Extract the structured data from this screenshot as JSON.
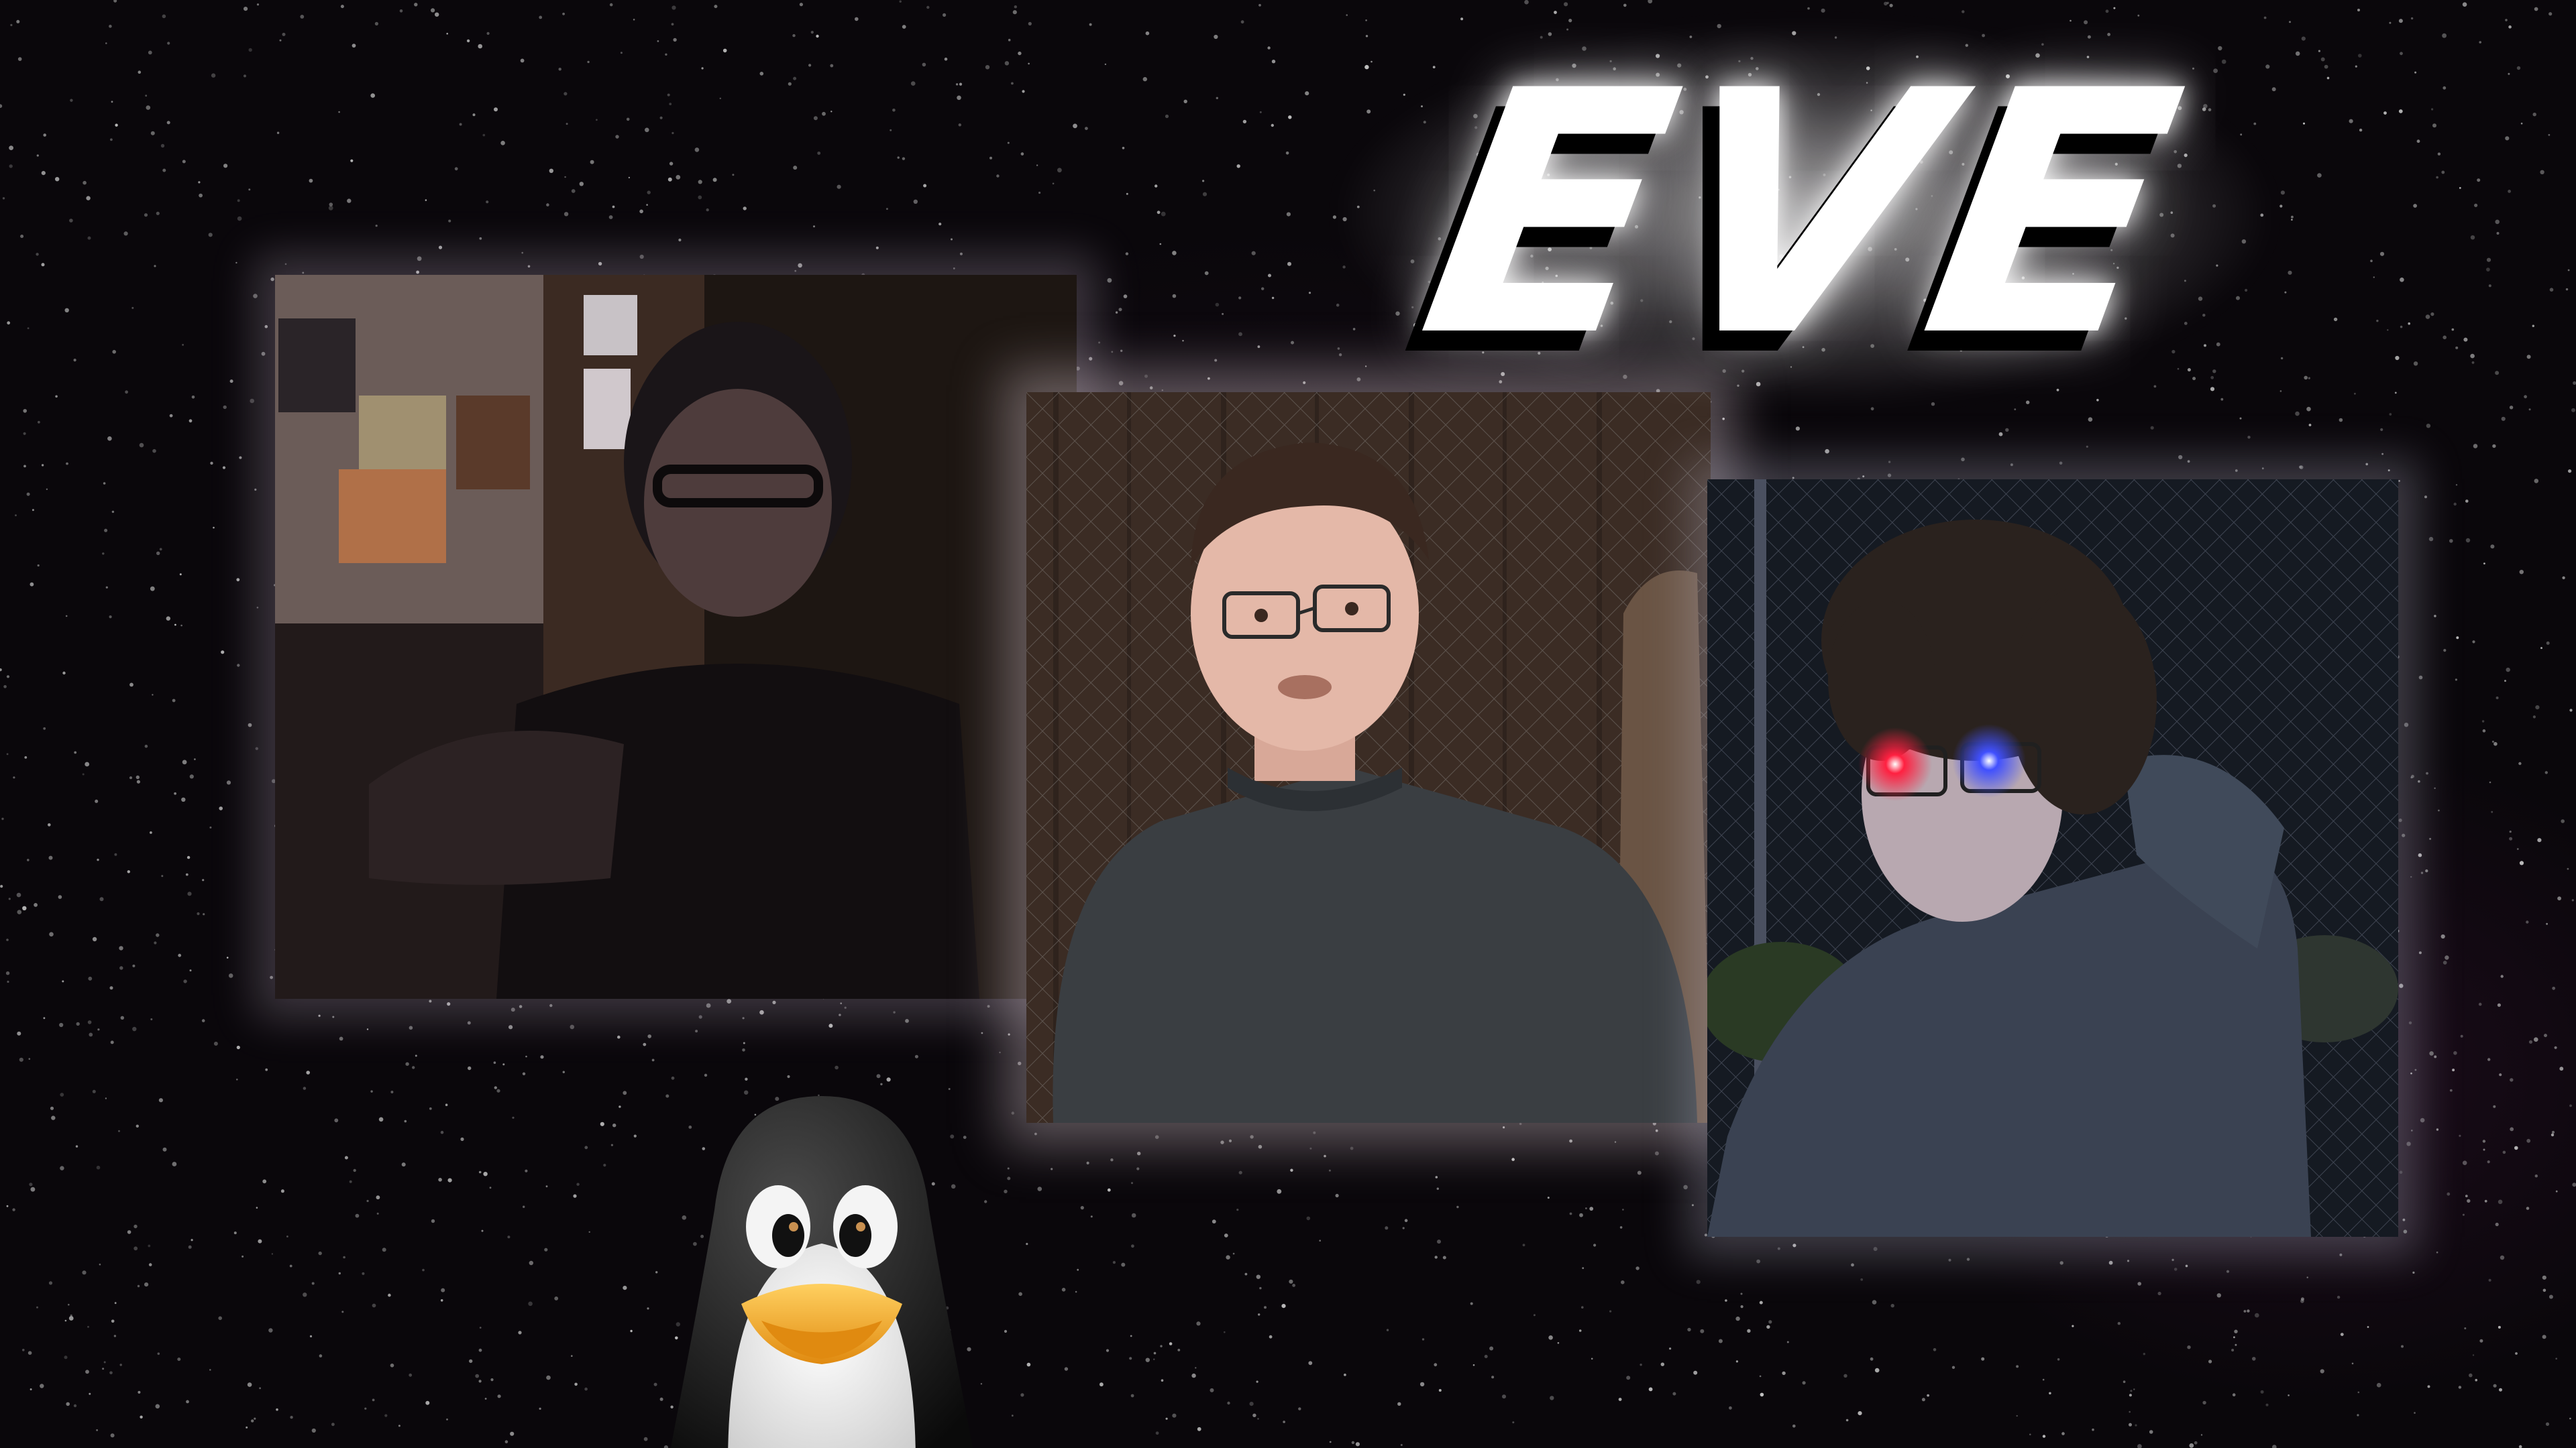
{
  "title": "EVE",
  "colors": {
    "background": "#0a070b",
    "title_fill": "#ffffff",
    "title_shadow": "#000000",
    "eye_glow_red": "#ff2040",
    "eye_glow_blue": "#4050ff",
    "penguin_beak": "#f5a623"
  },
  "images": [
    {
      "name": "photo-person-webcam-dark-room"
    },
    {
      "name": "photo-person-grey-sweater-fence"
    },
    {
      "name": "photo-person-hoodie-glowing-eyes"
    },
    {
      "name": "tux-penguin-mascot"
    }
  ]
}
